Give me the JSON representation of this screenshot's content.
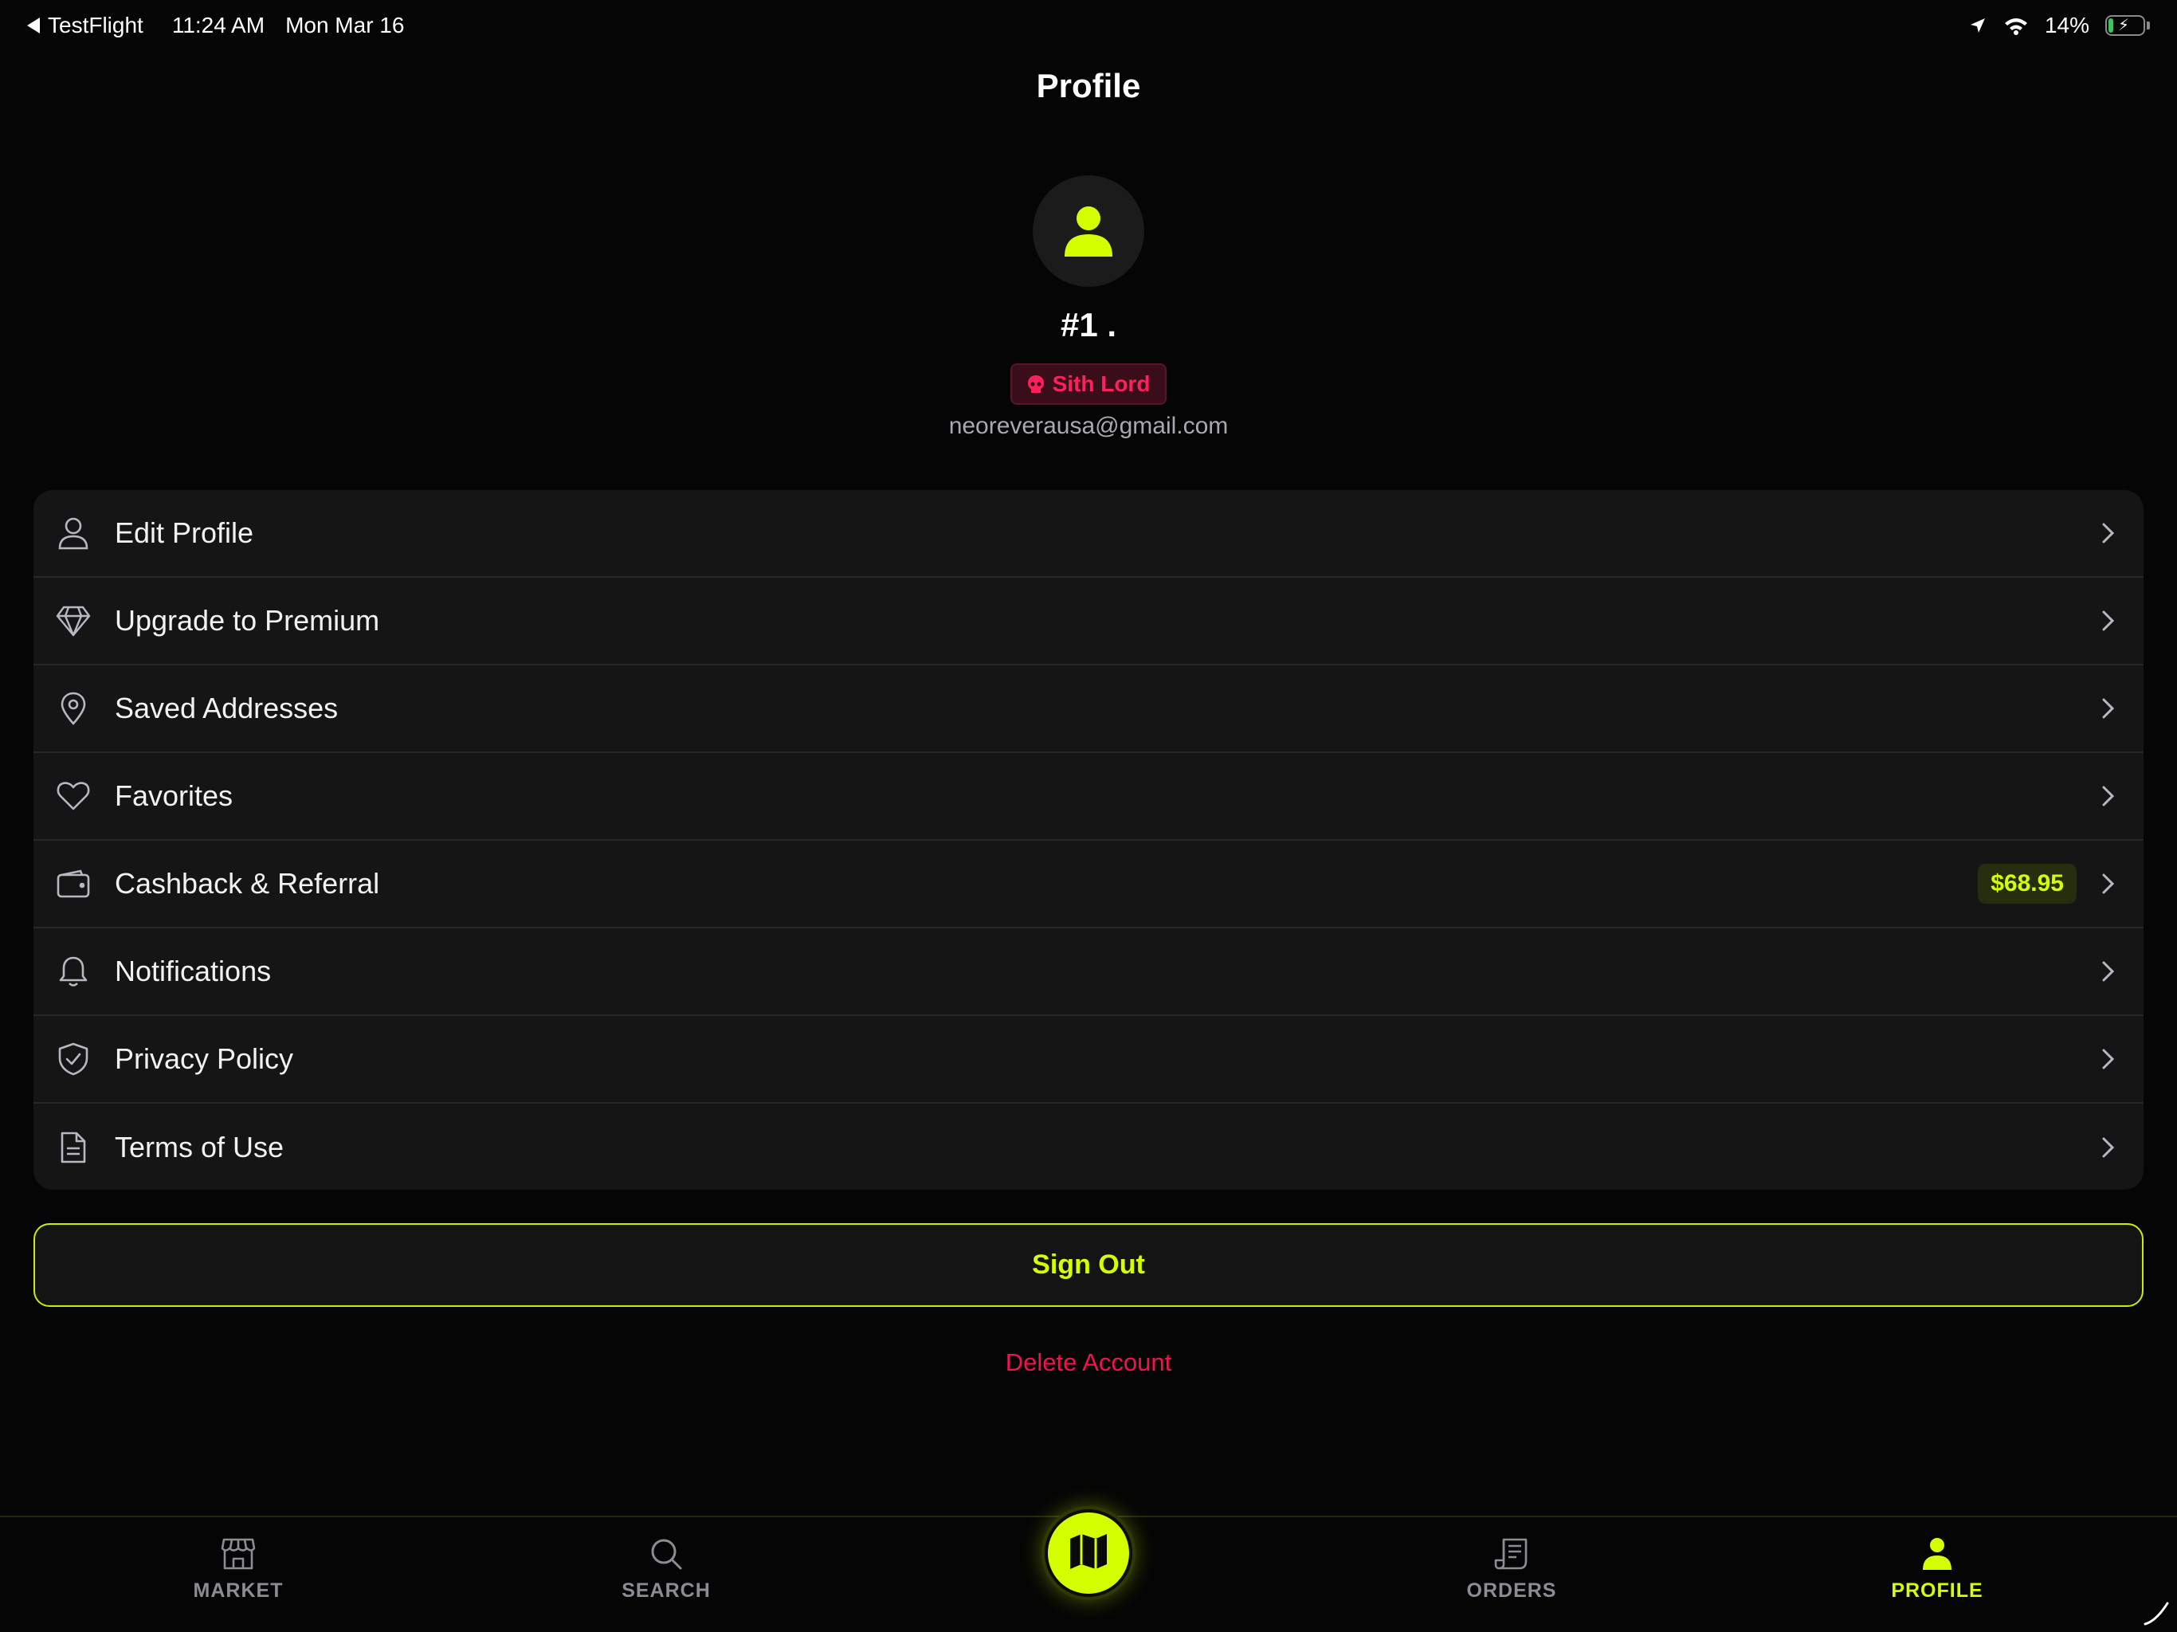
{
  "status_bar": {
    "back_app": "TestFlight",
    "time": "11:24 AM",
    "date": "Mon Mar 16",
    "battery": "14%",
    "battery_level": 0.14
  },
  "header": {
    "title": "Profile"
  },
  "profile": {
    "display_name": "#1 .",
    "role": "Sith Lord",
    "email": "neoreverausa@gmail.com"
  },
  "menu": {
    "items": [
      {
        "label": "Edit Profile",
        "icon": "user-icon"
      },
      {
        "label": "Upgrade to Premium",
        "icon": "diamond-icon"
      },
      {
        "label": "Saved Addresses",
        "icon": "location-pin-icon"
      },
      {
        "label": "Favorites",
        "icon": "heart-icon"
      },
      {
        "label": "Cashback & Referral",
        "icon": "wallet-icon",
        "badge": "$68.95"
      },
      {
        "label": "Notifications",
        "icon": "bell-icon"
      },
      {
        "label": "Privacy Policy",
        "icon": "shield-check-icon"
      },
      {
        "label": "Terms of Use",
        "icon": "document-icon"
      }
    ]
  },
  "actions": {
    "sign_out": "Sign Out",
    "delete_account": "Delete Account"
  },
  "tab_bar": {
    "tabs": [
      {
        "label": "MARKET",
        "icon": "storefront-icon",
        "active": false
      },
      {
        "label": "SEARCH",
        "icon": "search-icon",
        "active": false
      },
      {
        "label": "ORDERS",
        "icon": "receipt-icon",
        "active": false
      },
      {
        "label": "PROFILE",
        "icon": "user-icon",
        "active": true
      }
    ],
    "center_icon": "map-icon"
  },
  "colors": {
    "accent": "#d4ff00",
    "danger": "#f0134f",
    "background": "#050505",
    "card": "#151516"
  }
}
